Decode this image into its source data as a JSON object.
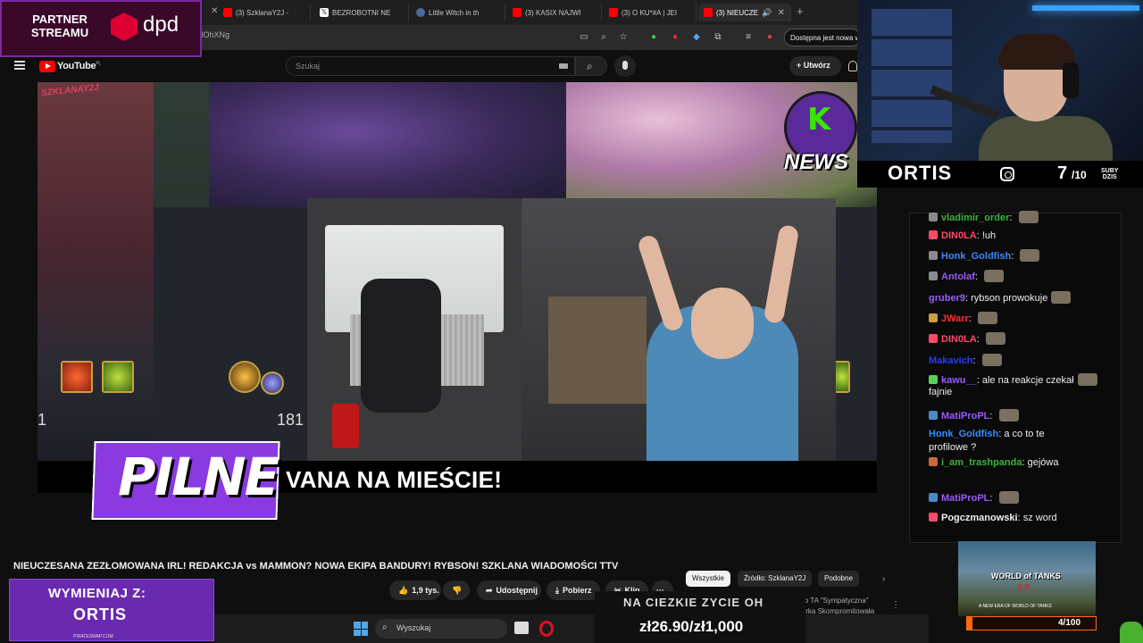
{
  "browser": {
    "tabs": [
      {
        "label": "(3) SzklanaY2J -",
        "favicon_color": "#ff0000"
      },
      {
        "label": "BEZROBOTNI NE",
        "favicon_color": "#ffffff"
      },
      {
        "label": "Little Witch in th",
        "favicon_color": "#1b2838"
      },
      {
        "label": "(3) KASIX NAJWI",
        "favicon_color": "#ff0000"
      },
      {
        "label": "(3) O KU*#A | JEI",
        "favicon_color": "#ff0000"
      },
      {
        "label": "(3) NIEUCZE",
        "favicon_color": "#ff0000",
        "active": true
      }
    ],
    "url_fragment": "IOhXNg",
    "update_notice": "Dostępna jest nowa w"
  },
  "youtube": {
    "logo_text": "YouTube",
    "region": "PL",
    "search_placeholder": "Szukaj",
    "create_label": "Utwórz",
    "video_title": "NIEUCZESANA ZEZŁOMOWANA IRL! REDAKCJA vs MAMMON? NOWA EKIPA BANDURY! RYBSON! SZKLANA WIADOMOŚCI TTV",
    "actions": {
      "likes": "1,9 tys.",
      "share": "Udostępnij",
      "download": "Pobierz",
      "clip": "Klip",
      "more": "···"
    },
    "chips": [
      "Wszystkie",
      "Źródło: SzklanaY2J",
      "Podobne"
    ],
    "related_line1": "Dlaczego TA \"Sympatyczna\"",
    "related_line2": "Streamerka Skompromitowała"
  },
  "video": {
    "watermark": "SZKLANAY2J",
    "news_letter": "K",
    "news_label": "NEWS",
    "pilne_label": "PILNE",
    "headline": "VANA NA MIEŚCIE!",
    "game_value_left": "1",
    "game_value_right": "181"
  },
  "taskbar": {
    "search_label": "Wyszukaj"
  },
  "overlays": {
    "partner_line1": "PARTNER",
    "partner_line2": "STREAMU",
    "sponsor": "dpd",
    "wymieniaj_line1": "WYMIENIAJ Z:",
    "wymieniaj_line2": "ORTIS",
    "pirateswap": "PIRATESWAP.COM",
    "goal_title": "NA CIEZKIE ZYCIE OH",
    "goal_amount": "zł26.90/zł1,000"
  },
  "streamer": {
    "name": "ORTIS",
    "subs_today": "7",
    "subs_goal": "/10",
    "subs_label_1": "SUBY",
    "subs_label_2": "DZIS"
  },
  "chat": [
    {
      "user": "vladimir_order",
      "text": "",
      "color": "#3cb43c",
      "badge": "#8a8a8a",
      "emote": true
    },
    {
      "user": "DIN0LA",
      "text": "!uh",
      "color": "#ff4a6a",
      "badge": "#ff4a6a",
      "emote": false
    },
    {
      "user": "Honk_Goldfish",
      "text": "",
      "color": "#3a8aff",
      "badge": "#8a8a8a",
      "emote": true
    },
    {
      "user": "Antolaf",
      "text": "",
      "color": "#9a5aff",
      "badge": "#8a8a8a",
      "emote": true
    },
    {
      "user": "gruber9",
      "text": "rybson prowokuje",
      "color": "#9a5aff",
      "badge": "",
      "emote": true
    },
    {
      "user": "JWarr",
      "text": "",
      "color": "#ff3030",
      "badge": "#c8a040",
      "emote": true
    },
    {
      "user": "DIN0LA",
      "text": "",
      "color": "#ff4a6a",
      "badge": "#ff4a6a",
      "emote": true
    },
    {
      "user": "Makavich",
      "text": "",
      "color": "#2a3aff",
      "badge": "",
      "emote": true
    },
    {
      "user": "kawu__",
      "text": "ale na reakcje czekał",
      "text2": "fajnie",
      "color": "#9a5aff",
      "badge": "#5ad05a",
      "emote": true
    },
    {
      "user": "MatiProPL",
      "text": "",
      "color": "#9a5aff",
      "badge": "#4a8ac8",
      "emote": true
    },
    {
      "user": "Honk_Goldfish",
      "text": "a co to te",
      "text2": "profilowe ?",
      "color": "#3a8aff",
      "badge": "",
      "emote": false
    },
    {
      "user": "i_am_trashpanda",
      "text": "gejówa",
      "color": "#3cb43c",
      "badge": "#c86a3a",
      "emote": false
    },
    {
      "user": "MatiProPL",
      "text": "",
      "color": "#9a5aff",
      "badge": "#4a8ac8",
      "emote": true
    },
    {
      "user": "Pogczmanowski",
      "text": "sz word",
      "color": "#efeff1",
      "badge": "#ff4a6a",
      "emote": false
    }
  ],
  "wot": {
    "logo": "WORLD of TANKS",
    "version": "2.0",
    "tagline": "A NEW ERA OF WORLD OF TANKS",
    "progress_text": "4/100",
    "progress_fraction": 0.04
  },
  "colors": {
    "youtube_red": "#ff0000",
    "pilne_purple": "#8a3ae0",
    "dpd_red": "#dc0032",
    "wot_orange": "#ff6a10"
  }
}
